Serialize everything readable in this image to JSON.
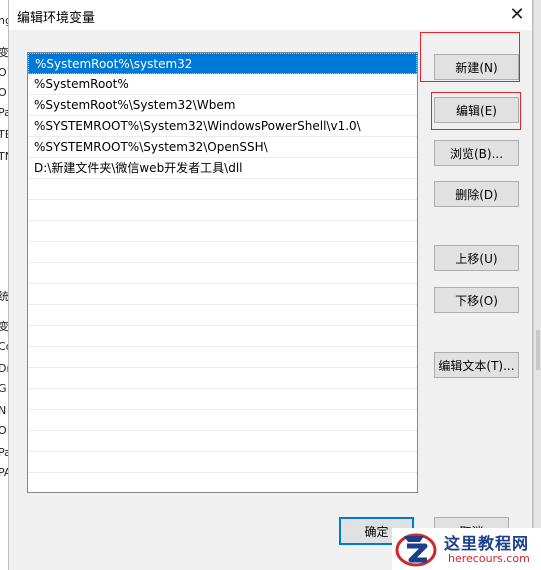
{
  "background": {
    "left_fragments": [
      "ng",
      "变",
      "O",
      "O",
      "Pa",
      "TE",
      "TN",
      "统",
      "变",
      "Co",
      "Dr",
      "G",
      "N",
      "O",
      "Pa",
      "PA"
    ]
  },
  "dialog": {
    "title": "编辑环境变量",
    "close_glyph": "✕",
    "entries": [
      "%SystemRoot%\\system32",
      "%SystemRoot%",
      "%SystemRoot%\\System32\\Wbem",
      "%SYSTEMROOT%\\System32\\WindowsPowerShell\\v1.0\\",
      "%SYSTEMROOT%\\System32\\OpenSSH\\",
      "D:\\新建文件夹\\微信web开发者工具\\dll"
    ],
    "selected_index": 0,
    "buttons": {
      "new": "新建(N)",
      "edit": "编辑(E)",
      "browse": "浏览(B)...",
      "delete": "删除(D)",
      "move_up": "上移(U)",
      "move_down": "下移(O)",
      "edit_text": "编辑文本(T)..."
    },
    "footer": {
      "ok": "确定",
      "cancel": "取消"
    }
  },
  "watermark": {
    "title": "这里教程网",
    "url": "herecours.com"
  },
  "colors": {
    "selection": "#0078d7",
    "highlight_box": "#e2252b",
    "watermark_title": "#1b3f8b",
    "watermark_url": "#d0262c"
  }
}
